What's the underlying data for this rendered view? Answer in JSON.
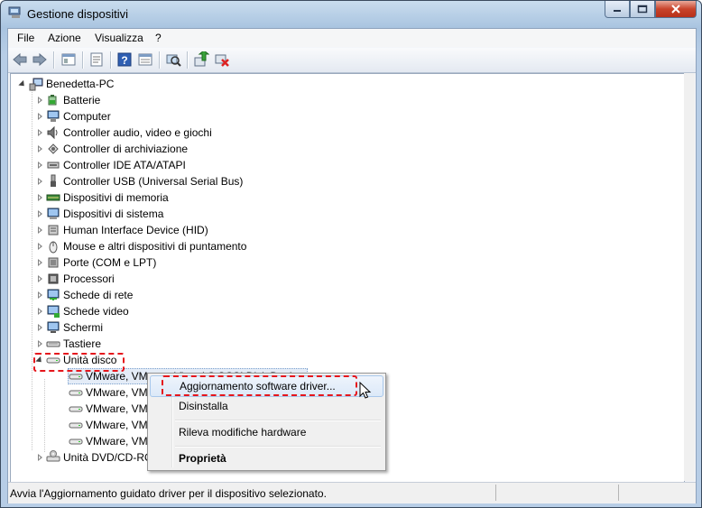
{
  "window": {
    "title": "Gestione dispositivi"
  },
  "menu": [
    "File",
    "Azione",
    "Visualizza",
    "?"
  ],
  "toolbar": {
    "buttons": [
      "back-icon",
      "forward-icon",
      "show-hide-tree-icon",
      "properties-icon",
      "help-icon",
      "view-icon",
      "scan-hardware-icon",
      "update-driver-icon",
      "uninstall-icon"
    ]
  },
  "tree": {
    "root": "Benedetta-PC",
    "categories": [
      "Batterie",
      "Computer",
      "Controller audio, video e giochi",
      "Controller di archiviazione",
      "Controller IDE ATA/ATAPI",
      "Controller USB (Universal Serial Bus)",
      "Dispositivi di memoria",
      "Dispositivi di sistema",
      "Human Interface Device (HID)",
      "Mouse e altri dispositivi di puntamento",
      "Porte (COM e LPT)",
      "Processori",
      "Schede di rete",
      "Schede video",
      "Schermi",
      "Tastiere",
      "Unità disco"
    ],
    "disks": [
      "VMware, VMware Virtual S SCSI Disk Device",
      "VMware, VMv",
      "VMware, VMv",
      "VMware, VMv",
      "VMware, VMv"
    ],
    "dvd": "Unità DVD/CD-RO"
  },
  "context_menu": {
    "update": "Aggiornamento software driver...",
    "uninstall": "Disinstalla",
    "scan": "Rileva modifiche hardware",
    "properties": "Proprietà"
  },
  "status": {
    "text": "Avvia l'Aggiornamento guidato driver per il dispositivo selezionato."
  },
  "colors": {
    "highlight_dash": "#e5161c",
    "close_button": "#c8432b"
  }
}
